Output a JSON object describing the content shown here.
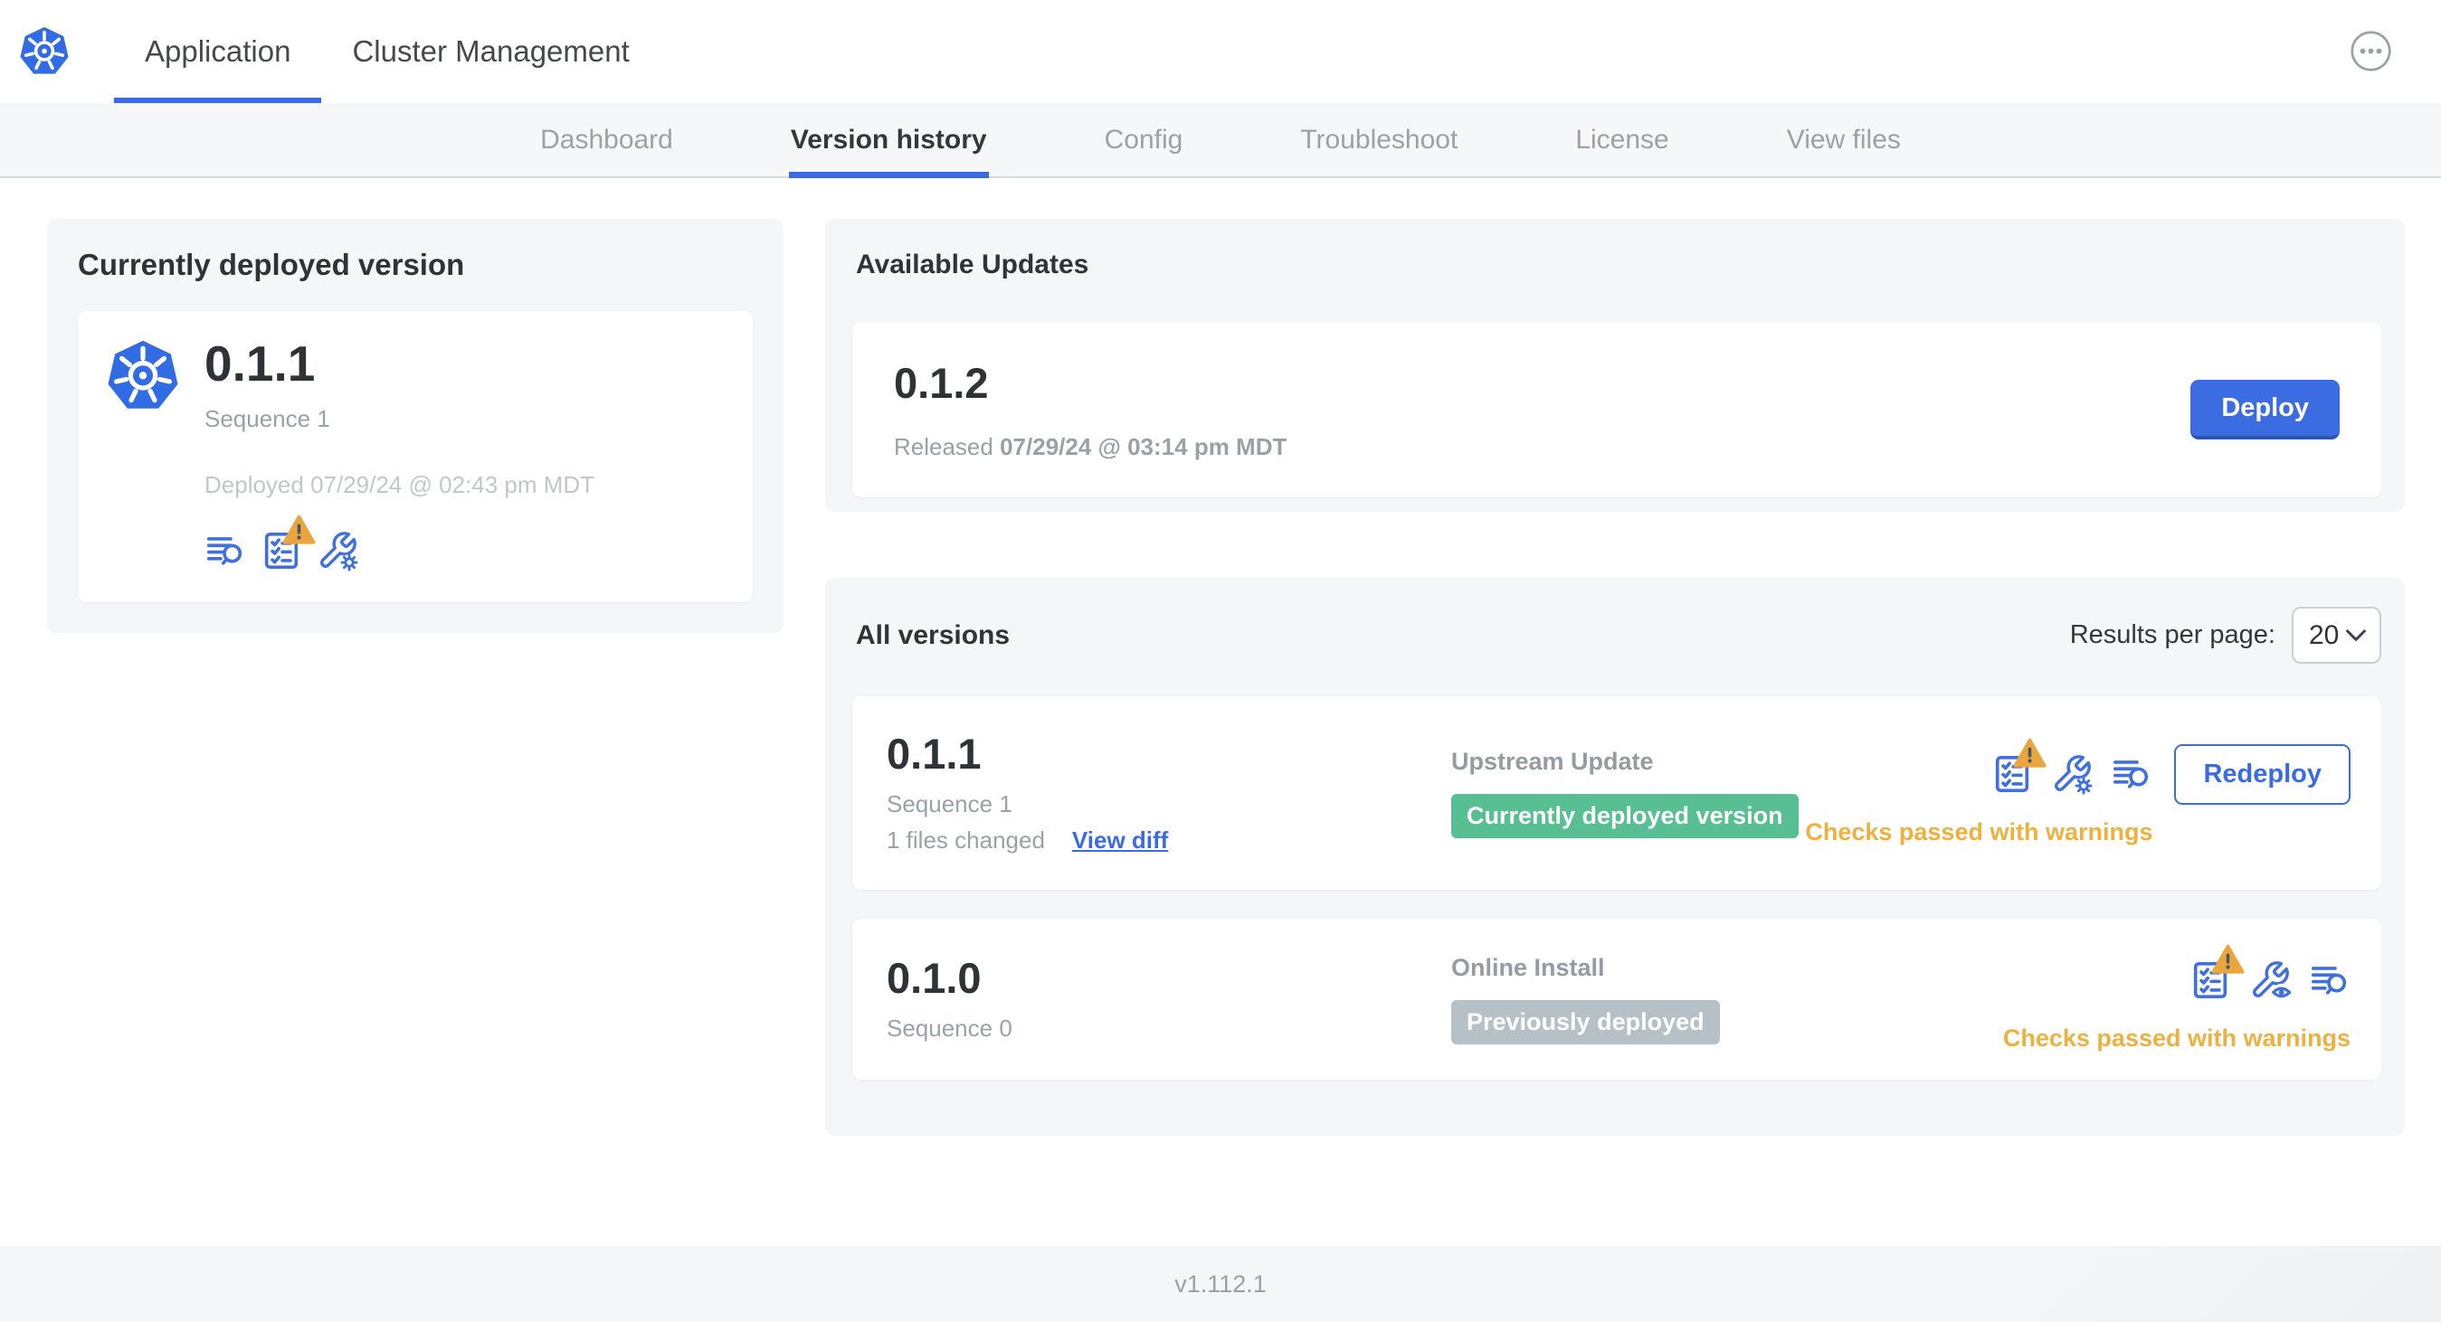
{
  "header": {
    "logo_icon": "kubernetes-logo-icon",
    "tabs": [
      {
        "label": "Application",
        "active": true
      },
      {
        "label": "Cluster Management",
        "active": false
      }
    ],
    "more_icon": "ellipsis-icon"
  },
  "subnav": {
    "tabs": [
      {
        "label": "Dashboard",
        "active": false
      },
      {
        "label": "Version history",
        "active": true
      },
      {
        "label": "Config",
        "active": false
      },
      {
        "label": "Troubleshoot",
        "active": false
      },
      {
        "label": "License",
        "active": false
      },
      {
        "label": "View files",
        "active": false
      }
    ]
  },
  "current": {
    "title": "Currently deployed version",
    "app_icon": "kubernetes-logo-icon",
    "version": "0.1.1",
    "sequence": "Sequence 1",
    "deployed": "Deployed 07/29/24 @ 02:43 pm MDT",
    "icons": [
      "release-notes-icon",
      "preflight-checks-warning-icon",
      "config-edit-icon"
    ]
  },
  "updates": {
    "title": "Available Updates",
    "version": "0.1.2",
    "released_prefix": "Released",
    "released_date": "07/29/24 @ 03:14 pm MDT",
    "deploy_label": "Deploy"
  },
  "versions": {
    "title": "All versions",
    "results_per_page_label": "Results per page:",
    "results_per_page_value": "20",
    "rows": [
      {
        "version": "0.1.1",
        "sequence": "Sequence 1",
        "files_changed": "1 files changed",
        "view_diff_label": "View diff",
        "source": "Upstream Update",
        "badge_label": "Currently deployed version",
        "badge_type": "green",
        "icons": [
          "preflight-checks-warning-icon",
          "config-edit-icon",
          "release-notes-icon"
        ],
        "action_label": "Redeploy",
        "status": "Checks passed with warnings"
      },
      {
        "version": "0.1.0",
        "sequence": "Sequence 0",
        "source": "Online Install",
        "badge_label": "Previously deployed",
        "badge_type": "gray",
        "icons": [
          "preflight-checks-warning-icon",
          "config-view-icon",
          "release-notes-icon"
        ],
        "status": "Checks passed with warnings"
      }
    ]
  },
  "footer": {
    "version": "v1.112.1"
  },
  "colors": {
    "accent_blue": "#3b6be4",
    "icon_blue": "#4070e0",
    "kubernetes_blue": "#326ce5",
    "warning_orange": "#eeb03f",
    "badge_green": "#57bf91",
    "badge_gray": "#b6c0c7",
    "panel_gray": "#f5f6f8"
  }
}
